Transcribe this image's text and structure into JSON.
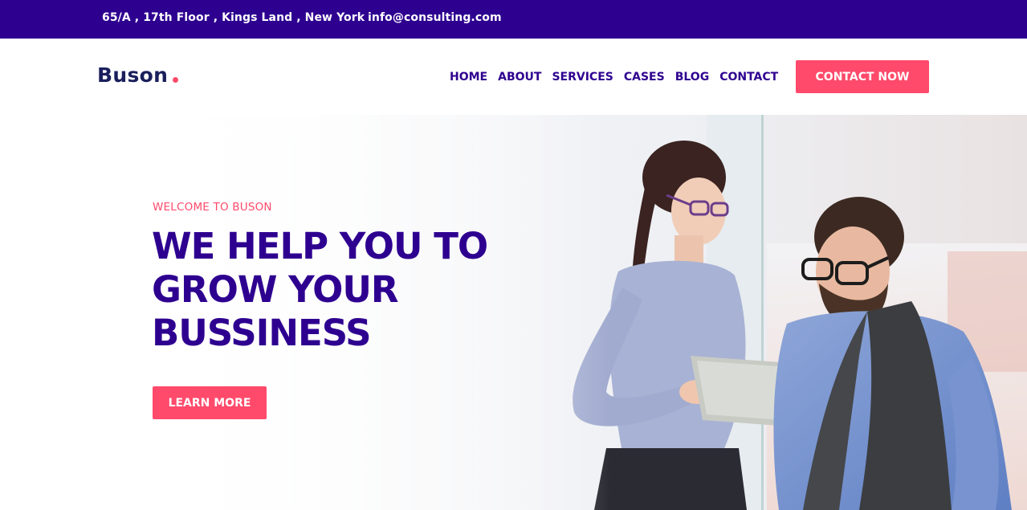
{
  "topbar": {
    "address": "65/A , 17th Floor , Kings Land , New York",
    "email": "info@consulting.com"
  },
  "header": {
    "logo": "Buson",
    "nav": [
      "HOME",
      "ABOUT",
      "SERVICES",
      "CASES",
      "BLOG",
      "CONTACT"
    ],
    "cta_label": "CONTACT NOW"
  },
  "hero": {
    "subtitle": "WELCOME TO BUSON",
    "title_lines": [
      "WE HELP YOU TO",
      "GROW YOUR",
      "BUSSINESS"
    ],
    "button_label": "LEARN MORE",
    "image": "two-business-people-with-tablet"
  },
  "colors": {
    "brand_purple": "#2e0090",
    "accent_pink": "#ff4a6b",
    "logo_navy": "#1a1f5c"
  }
}
